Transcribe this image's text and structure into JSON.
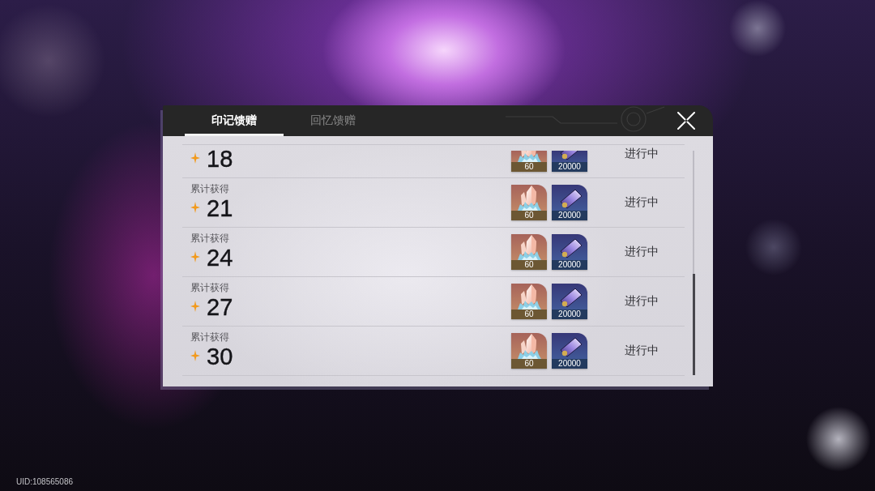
{
  "tabs": [
    {
      "label": "印记馈赠",
      "selected": true
    },
    {
      "label": "回忆馈赠",
      "selected": false
    }
  ],
  "rows": [
    {
      "number": "18",
      "rewards": [
        {
          "kind": "crystal",
          "count": "60"
        },
        {
          "kind": "ticket",
          "count": "20000"
        }
      ],
      "status": "进行中"
    },
    {
      "label": "累计获得",
      "number": "21",
      "rewards": [
        {
          "kind": "crystal",
          "count": "60"
        },
        {
          "kind": "ticket",
          "count": "20000"
        }
      ],
      "status": "进行中"
    },
    {
      "label": "累计获得",
      "number": "24",
      "rewards": [
        {
          "kind": "crystal",
          "count": "60"
        },
        {
          "kind": "ticket",
          "count": "20000"
        }
      ],
      "status": "进行中"
    },
    {
      "label": "累计获得",
      "number": "27",
      "rewards": [
        {
          "kind": "crystal",
          "count": "60"
        },
        {
          "kind": "ticket",
          "count": "20000"
        }
      ],
      "status": "进行中"
    },
    {
      "label": "累计获得",
      "number": "30",
      "rewards": [
        {
          "kind": "crystal",
          "count": "60"
        },
        {
          "kind": "ticket",
          "count": "20000"
        }
      ],
      "status": "进行中"
    }
  ],
  "uid": "UID:108565086"
}
